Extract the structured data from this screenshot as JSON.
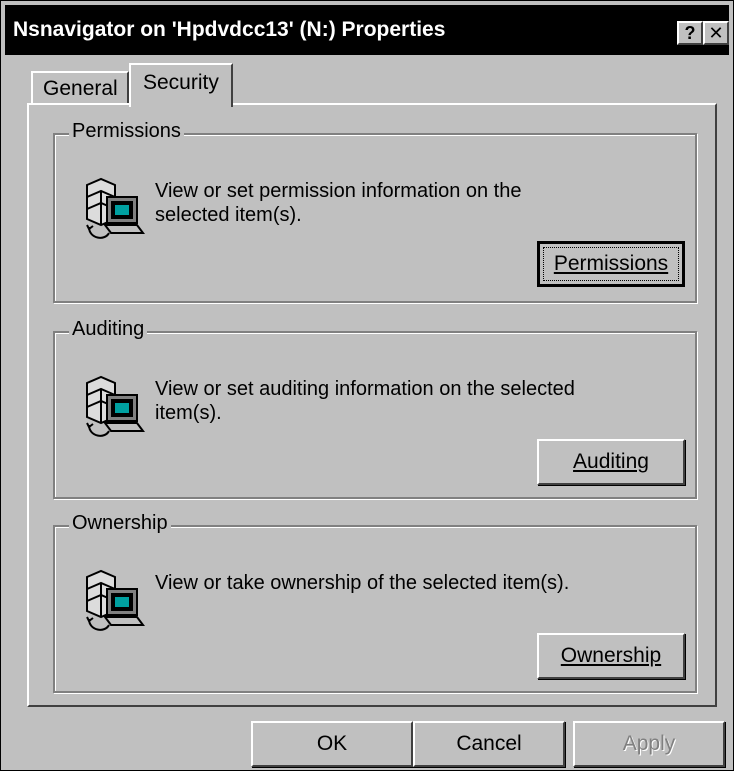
{
  "window": {
    "title": "Nsnavigator on 'Hpdvdcc13' (N:) Properties",
    "help_label": "?",
    "close_label": "✕"
  },
  "tabs": [
    {
      "label": "General",
      "active": false
    },
    {
      "label": "Security",
      "active": true
    }
  ],
  "sections": {
    "permissions": {
      "label": "Permissions",
      "description": "View or set permission information on the selected item(s).",
      "button": "Permissions",
      "icon": "security-computer-icon"
    },
    "auditing": {
      "label": "Auditing",
      "description": "View or set auditing information on the selected item(s).",
      "button": "Auditing",
      "icon": "security-computer-icon"
    },
    "ownership": {
      "label": "Ownership",
      "description": "View or take ownership of the selected item(s).",
      "button": "Ownership",
      "icon": "security-computer-icon"
    }
  },
  "footer": {
    "ok": "OK",
    "cancel": "Cancel",
    "apply": "Apply"
  },
  "colors": {
    "face": "#c0c0c0",
    "titlebar": "#000000",
    "disabled_text": "#808080"
  }
}
